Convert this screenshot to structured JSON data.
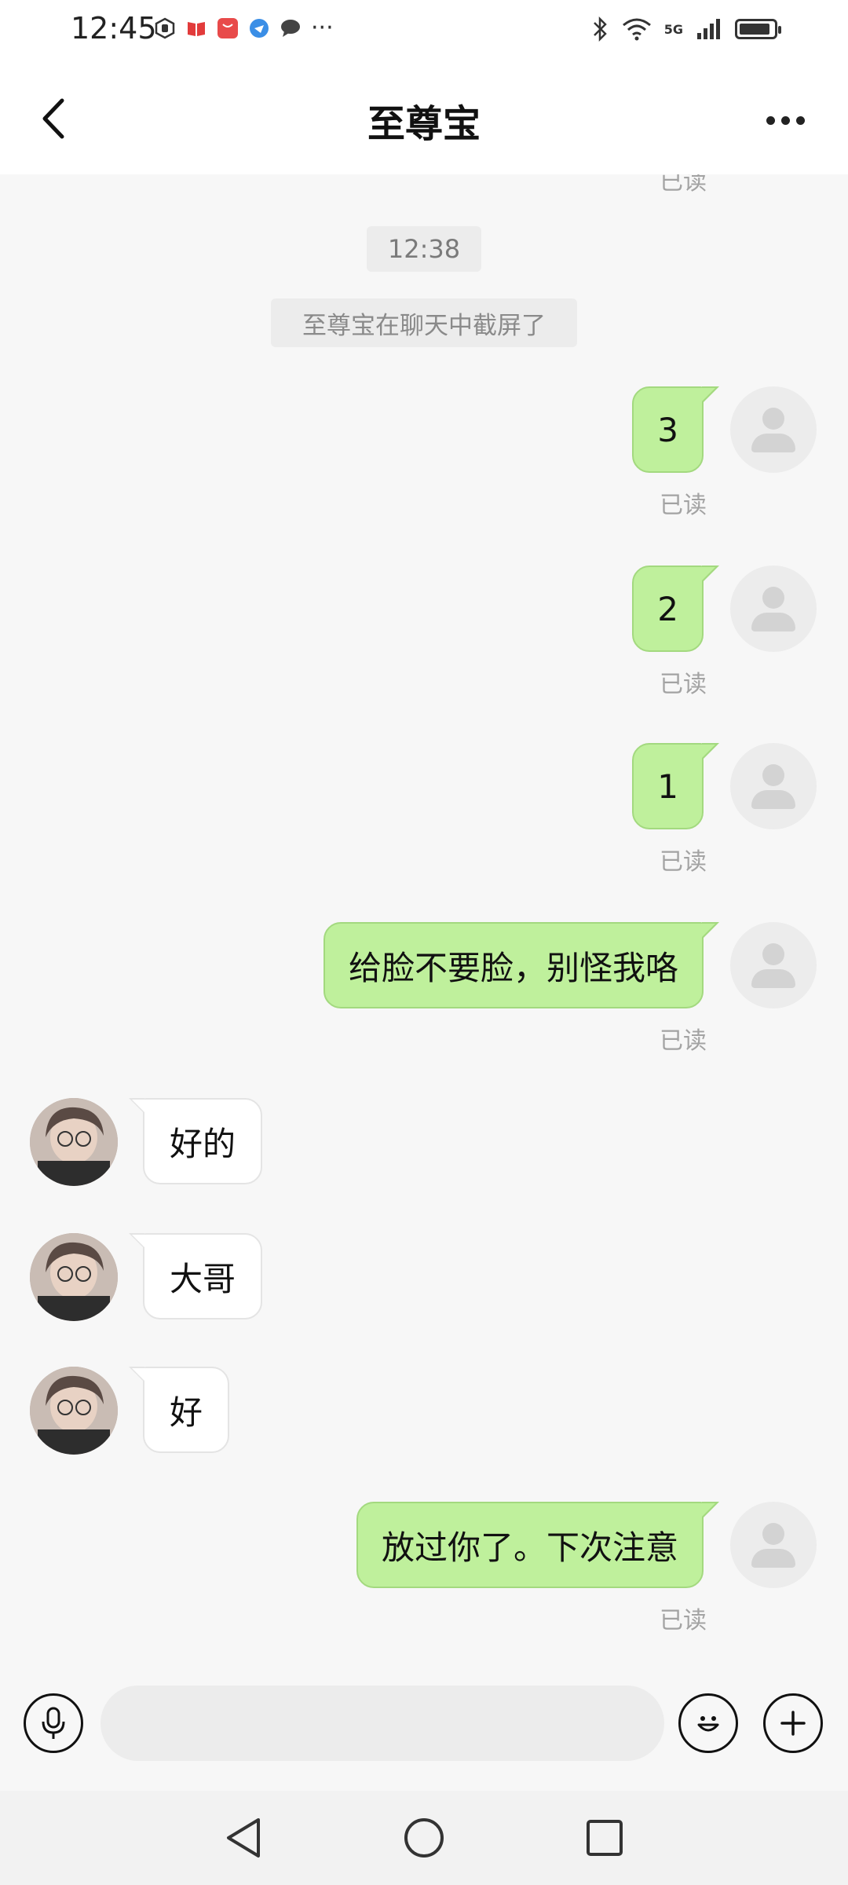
{
  "status_bar": {
    "time": "12:45",
    "network": "5G"
  },
  "header": {
    "title": "至尊宝"
  },
  "chat": {
    "timestamp": "12:38",
    "system_note": "至尊宝在聊天中截屏了",
    "top_partial_read": "已读",
    "messages": [
      {
        "side": "out",
        "text": "3",
        "status": "已读"
      },
      {
        "side": "out",
        "text": "2",
        "status": "已读"
      },
      {
        "side": "out",
        "text": "1",
        "status": "已读"
      },
      {
        "side": "out",
        "text": "给脸不要脸，别怪我咯",
        "status": "已读"
      },
      {
        "side": "in",
        "text": "好的"
      },
      {
        "side": "in",
        "text": "大哥"
      },
      {
        "side": "in",
        "text": "好"
      },
      {
        "side": "out",
        "text": "放过你了。下次注意",
        "status": "已读"
      }
    ]
  },
  "input_bar": {
    "value": "",
    "placeholder": ""
  },
  "icons": {
    "back": "chevron-left-icon",
    "more": "more-dots-icon",
    "voice": "microphone-icon",
    "emoji": "smiley-icon",
    "add": "plus-icon"
  },
  "colors": {
    "outgoing_bubble": "#bff09c",
    "incoming_bubble": "#ffffff",
    "background": "#f7f7f7"
  }
}
